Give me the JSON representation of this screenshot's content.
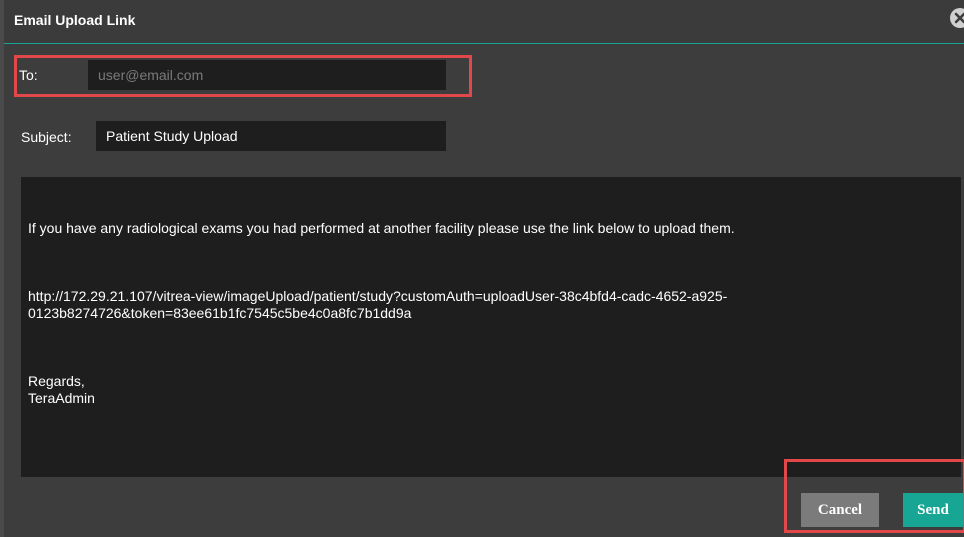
{
  "dialog": {
    "title": "Email Upload Link",
    "close_icon": "close-circle-icon"
  },
  "to": {
    "label": "To:",
    "value": "",
    "placeholder": "user@email.com"
  },
  "subject": {
    "label": "Subject:",
    "value": "Patient Study Upload"
  },
  "message": {
    "intro": "If you have any radiological exams you had performed at another facility please use the link below to upload them.",
    "link": "http://172.29.21.107/vitrea-view/imageUpload/patient/study?customAuth=uploadUser-38c4bfd4-cadc-4652-a925-\n0123b8274726&token=83ee61b1fc7545c5be4c0a8fc7b1dd9a",
    "closing": "Regards,\nTeraAdmin"
  },
  "buttons": {
    "cancel": "Cancel",
    "send": "Send"
  },
  "colors": {
    "accent": "#17a594",
    "highlight": "#e2474a",
    "background": "#3d3d3d",
    "field": "#1e1e1e"
  }
}
